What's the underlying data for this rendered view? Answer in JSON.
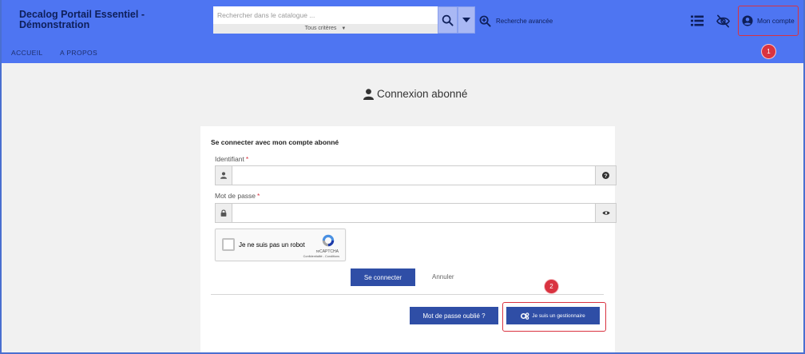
{
  "header": {
    "site_title": "Decalog Portail Essentiel - Démonstration",
    "search": {
      "placeholder": "Rechercher dans le catalogue ...",
      "value": "",
      "criteria_label": "Tous critères"
    },
    "advanced_search_label": "Recherche avancée",
    "account_label": "Mon compte",
    "nav": [
      "ACCUEIL",
      "A PROPOS"
    ]
  },
  "badges": {
    "account": "1",
    "manager": "2"
  },
  "login": {
    "title": "Connexion abonné",
    "card_heading": "Se connecter avec mon compte abonné",
    "identifier_label": "Identifiant",
    "password_label": "Mot de passe",
    "required_mark": "*",
    "identifier_value": "",
    "password_value": "",
    "captcha": {
      "label": "Je ne suis pas un robot",
      "brand": "reCAPTCHA",
      "links": "Confidentialité - Conditions"
    },
    "submit_label": "Se connecter",
    "cancel_label": "Annuler",
    "forgot_password_label": "Mot de passe oublié ?",
    "manager_label": "Je suis un gestionnaire"
  },
  "colors": {
    "header_bg": "#4e75f2",
    "primary_button": "#2f4ea6",
    "highlight_red": "#d93340"
  }
}
